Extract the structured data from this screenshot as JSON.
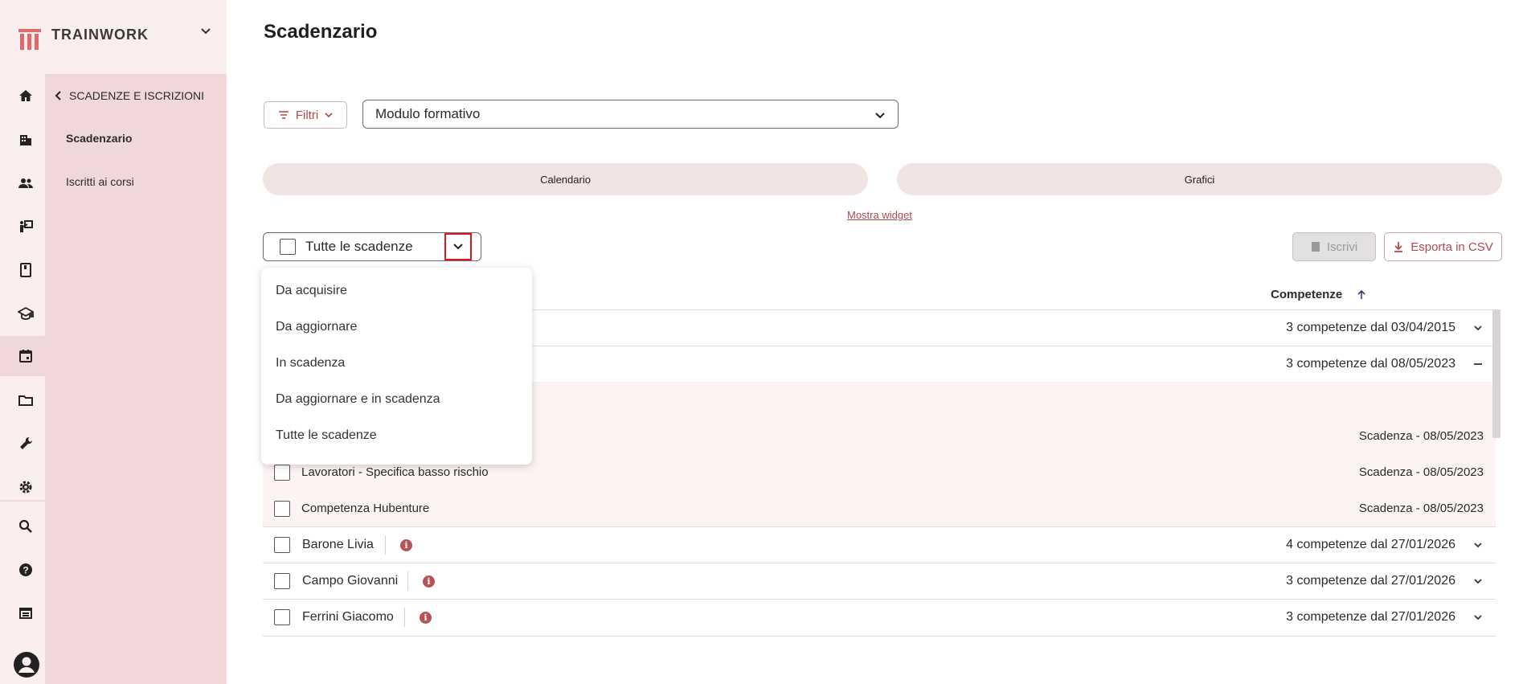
{
  "brand": {
    "name": "TRAINWORK"
  },
  "sidebar": {
    "icons": [
      "home-icon",
      "building-icon",
      "people-icon",
      "presentation-icon",
      "book-icon",
      "graduation-cap-icon",
      "calendar-icon",
      "folder-icon",
      "wrench-icon",
      "gear-icon",
      "search-icon",
      "help-icon",
      "inbox-icon",
      "account-icon"
    ],
    "active": "calendar-icon"
  },
  "subnav": {
    "back_label": "SCADENZE E ISCRIZIONI",
    "items": [
      "Scadenzario",
      "Iscritti ai corsi"
    ]
  },
  "page": {
    "title": "Scadenzario"
  },
  "toolbar": {
    "filter_label": "Filtri",
    "module_select_value": "Modulo formativo"
  },
  "tabs": {
    "calendar": "Calendario",
    "charts": "Grafici"
  },
  "show_widget": "Mostra widget",
  "scadenze_select": {
    "value": "Tutte le scadenze"
  },
  "actions": {
    "iscrivi": "Iscrivi",
    "export_csv": "Esporta in CSV"
  },
  "table": {
    "column_header": "Competenze",
    "rows": [
      {
        "name": "",
        "right": "3 competenze dal 03/04/2015",
        "expand": "chevron-down-icon"
      },
      {
        "name": "",
        "right": "3 competenze dal 08/05/2023",
        "expand": "minus-icon"
      },
      {
        "name": "",
        "right": "",
        "sub": true
      },
      {
        "name": "",
        "right": "Scadenza - 08/05/2023",
        "sub": true
      },
      {
        "name": "Lavoratori - Specifica basso rischio",
        "right": "Scadenza - 08/05/2023",
        "sub": true
      },
      {
        "name": "Competenza Hubenture",
        "right": "Scadenza - 08/05/2023",
        "sub": true
      },
      {
        "name": "Barone Livia",
        "right": "4 competenze dal 27/01/2026",
        "expand": "chevron-down-icon",
        "info": true
      },
      {
        "name": "Campo Giovanni",
        "right": "3 competenze dal 27/01/2026",
        "expand": "chevron-down-icon",
        "info": true
      },
      {
        "name": "Ferrini Giacomo",
        "right": "3 competenze dal 27/01/2026",
        "expand": "chevron-down-icon",
        "info": true
      }
    ]
  },
  "dropdown": {
    "options": [
      "Da acquisire",
      "Da aggiornare",
      "In scadenza",
      "Da aggiornare e in scadenza",
      "Tutte le scadenze"
    ]
  },
  "colors": {
    "accent": "#b04a4a",
    "sidebar_bg": "#fbeeee",
    "subnav_bg": "#f0d8da",
    "highlight": "#e0161c"
  }
}
